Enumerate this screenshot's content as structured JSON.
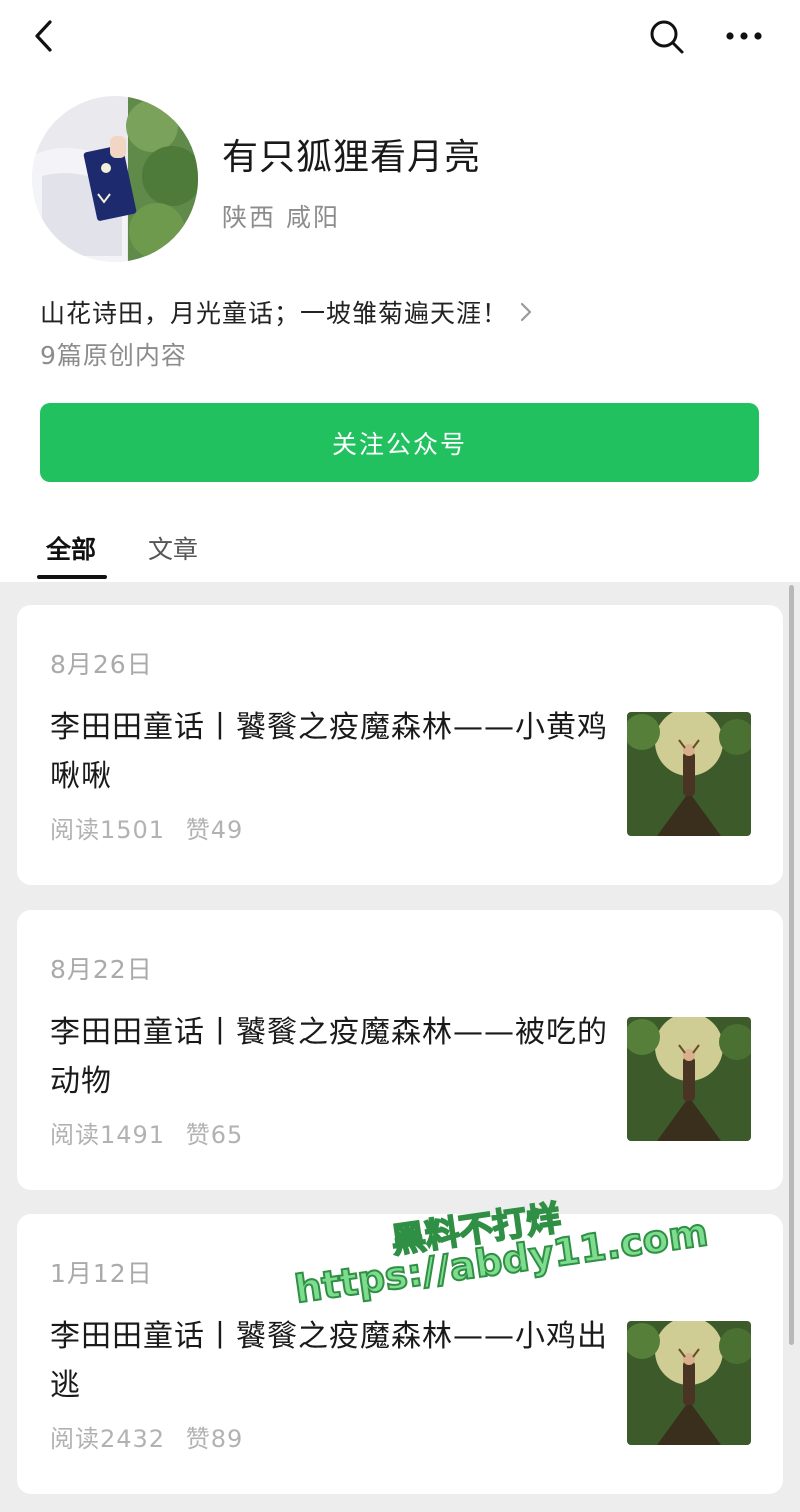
{
  "header": {
    "back_icon": "chevron-left-icon",
    "search_icon": "search-icon",
    "more_icon": "more-icon"
  },
  "profile": {
    "name": "有只狐狸看月亮",
    "location": "陕西 咸阳",
    "description": "山花诗田，月光童话；一坡雏菊遍天涯！",
    "original_count": "9篇原创内容",
    "follow_label": "关注公众号",
    "accent_color": "#21c160"
  },
  "tabs": [
    {
      "label": "全部",
      "active": true
    },
    {
      "label": "文章",
      "active": false
    }
  ],
  "articles": [
    {
      "date": "8月26日",
      "title": "李田田童话丨饕餮之疫魔森林——小黄鸡啾啾",
      "reads": "阅读1501",
      "likes": "赞49"
    },
    {
      "date": "8月22日",
      "title": "李田田童话丨饕餮之疫魔森林——被吃的动物",
      "reads": "阅读1491",
      "likes": "赞65"
    },
    {
      "date": "1月12日",
      "title": "李田田童话丨饕餮之疫魔森林——小鸡出逃",
      "reads": "阅读2432",
      "likes": "赞89"
    }
  ],
  "watermark": {
    "line1": "黑料不打烊",
    "line2": "https://abdy11.com"
  }
}
